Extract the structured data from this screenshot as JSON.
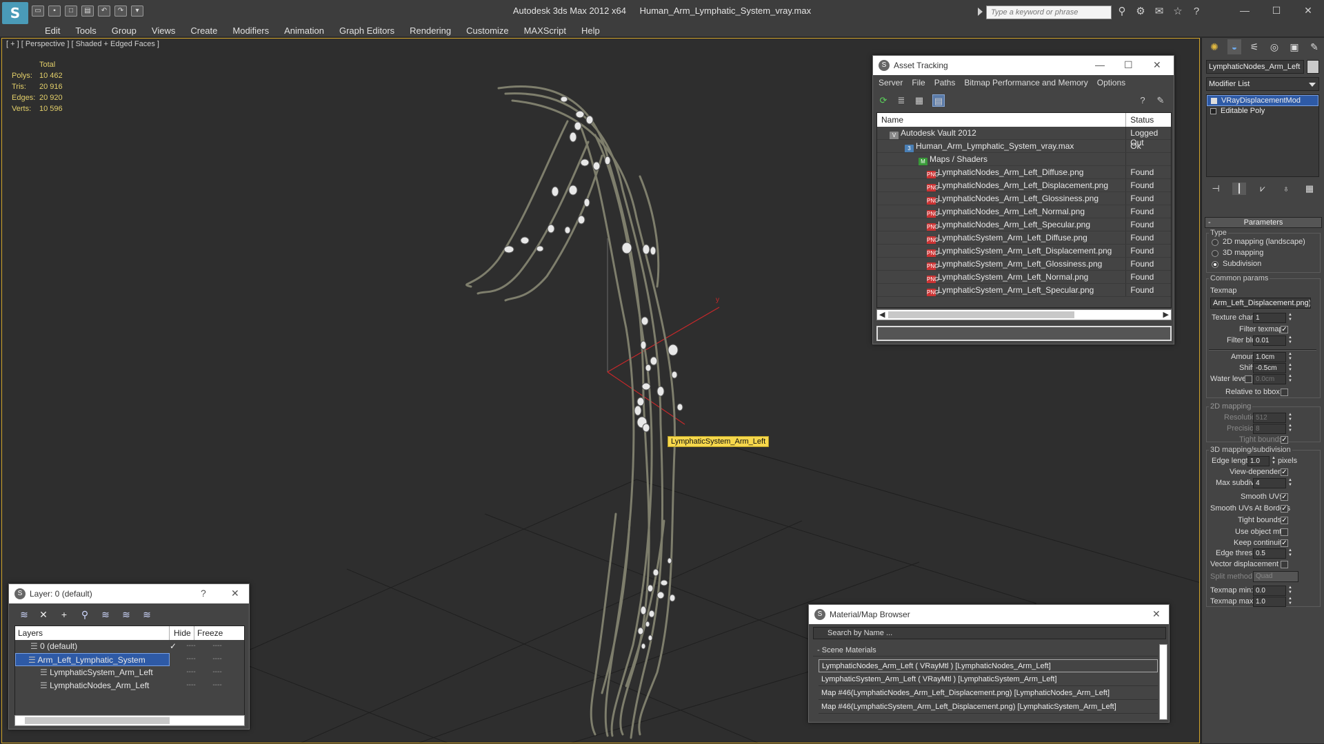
{
  "app": {
    "logo": "S",
    "title_app": "Autodesk 3ds Max  2012 x64",
    "title_file": "Human_Arm_Lymphatic_System_vray.max",
    "search_placeholder": "Type a keyword or phrase"
  },
  "menu": [
    "Edit",
    "Tools",
    "Group",
    "Views",
    "Create",
    "Modifiers",
    "Animation",
    "Graph Editors",
    "Rendering",
    "Customize",
    "MAXScript",
    "Help"
  ],
  "viewport": {
    "label": "[ + ] [ Perspective ] [ Shaded + Edged Faces ]",
    "stats_header": "Total",
    "stats": [
      {
        "k": "Polys:",
        "v": "10 462"
      },
      {
        "k": "Tris:",
        "v": "20 916"
      },
      {
        "k": "Edges:",
        "v": "20 920"
      },
      {
        "k": "Verts:",
        "v": "10 596"
      }
    ],
    "tooltip": "LymphaticSystem_Arm_Left",
    "axis_y": "y"
  },
  "asset_tracking": {
    "title": "Asset Tracking",
    "menu": [
      "Server",
      "File",
      "Paths",
      "Bitmap Performance and Memory",
      "Options"
    ],
    "col_name": "Name",
    "col_status": "Status",
    "rows": [
      {
        "name": "Autodesk Vault 2012",
        "status": "Logged Out",
        "indent": 18,
        "icon": "vault",
        "glyph": "V"
      },
      {
        "name": "Human_Arm_Lymphatic_System_vray.max",
        "status": "Ok",
        "indent": 40,
        "icon": "max",
        "glyph": "3"
      },
      {
        "name": "Maps / Shaders",
        "status": "",
        "indent": 60,
        "icon": "maps",
        "glyph": "M"
      },
      {
        "name": "LymphaticNodes_Arm_Left_Diffuse.png",
        "status": "Found",
        "indent": 72,
        "icon": "png",
        "glyph": "PNG"
      },
      {
        "name": "LymphaticNodes_Arm_Left_Displacement.png",
        "status": "Found",
        "indent": 72,
        "icon": "png",
        "glyph": "PNG"
      },
      {
        "name": "LymphaticNodes_Arm_Left_Glossiness.png",
        "status": "Found",
        "indent": 72,
        "icon": "png",
        "glyph": "PNG"
      },
      {
        "name": "LymphaticNodes_Arm_Left_Normal.png",
        "status": "Found",
        "indent": 72,
        "icon": "png",
        "glyph": "PNG"
      },
      {
        "name": "LymphaticNodes_Arm_Left_Specular.png",
        "status": "Found",
        "indent": 72,
        "icon": "png",
        "glyph": "PNG"
      },
      {
        "name": "LymphaticSystem_Arm_Left_Diffuse.png",
        "status": "Found",
        "indent": 72,
        "icon": "png",
        "glyph": "PNG"
      },
      {
        "name": "LymphaticSystem_Arm_Left_Displacement.png",
        "status": "Found",
        "indent": 72,
        "icon": "png",
        "glyph": "PNG"
      },
      {
        "name": "LymphaticSystem_Arm_Left_Glossiness.png",
        "status": "Found",
        "indent": 72,
        "icon": "png",
        "glyph": "PNG"
      },
      {
        "name": "LymphaticSystem_Arm_Left_Normal.png",
        "status": "Found",
        "indent": 72,
        "icon": "png",
        "glyph": "PNG"
      },
      {
        "name": "LymphaticSystem_Arm_Left_Specular.png",
        "status": "Found",
        "indent": 72,
        "icon": "png",
        "glyph": "PNG"
      }
    ]
  },
  "layer_panel": {
    "title": "Layer: 0 (default)",
    "help": "?",
    "col_layers": "Layers",
    "col_hide": "Hide",
    "col_freeze": "Freeze",
    "rows": [
      {
        "name": "0 (default)",
        "indent": 22,
        "check": "✓",
        "selected": false
      },
      {
        "name": "Arm_Left_Lymphatic_System",
        "indent": 18,
        "check": "",
        "selected": true
      },
      {
        "name": "LymphaticSystem_Arm_Left",
        "indent": 36,
        "check": "",
        "selected": false
      },
      {
        "name": "LymphaticNodes_Arm_Left",
        "indent": 36,
        "check": "",
        "selected": false
      }
    ],
    "dash": "----"
  },
  "material_browser": {
    "title": "Material/Map Browser",
    "search": "Search by Name ...",
    "section": "Scene Materials",
    "rows": [
      "LymphaticNodes_Arm_Left  ( VRayMtl ) [LymphaticNodes_Arm_Left]",
      "LymphaticSystem_Arm_Left  ( VRayMtl ) [LymphaticSystem_Arm_Left]",
      "Map #46(LymphaticNodes_Arm_Left_Displacement.png) [LymphaticNodes_Arm_Left]",
      "Map #46(LymphaticSystem_Arm_Left_Displacement.png) [LymphaticSystem_Arm_Left]"
    ]
  },
  "command_panel": {
    "object_name": "LymphaticNodes_Arm_Left",
    "modifier_list": "Modifier List",
    "stack": [
      "VRayDisplacementMod",
      "Editable Poly"
    ],
    "parameters": "Parameters",
    "type_label": "Type",
    "types": [
      "2D mapping (landscape)",
      "3D mapping",
      "Subdivision"
    ],
    "common_params": "Common params",
    "texmap_label": "Texmap",
    "texmap_value": "Arm_Left_Displacement.png)",
    "texture_chan": "Texture chan",
    "texture_chan_v": "1",
    "filter_texmap": "Filter texmap",
    "filter_blur": "Filter blur",
    "filter_blur_v": "0.01",
    "amount": "Amount",
    "amount_v": "1.0cm",
    "shift": "Shift",
    "shift_v": "-0.5cm",
    "water_level": "Water level",
    "water_level_v": "0.0cm",
    "relative_bbox": "Relative to bbox",
    "map2d": "2D mapping",
    "resolution": "Resolution",
    "resolution_v": "512",
    "precision": "Precision",
    "precision_v": "8",
    "tight_bounds": "Tight bounds",
    "map3d": "3D mapping/subdivision",
    "edge_length": "Edge length",
    "edge_length_v": "1.0",
    "pixels": "pixels",
    "view_dependent": "View-dependent",
    "max_subdivs": "Max subdivs",
    "max_subdivs_v": "4",
    "smooth_uvs": "Smooth UVs",
    "smooth_uvs_borders": "Smooth UVs At Borders",
    "tight_bounds2": "Tight bounds",
    "use_object_mtl": "Use object mtl",
    "keep_continuity": "Keep continuity",
    "edge_thresh": "Edge thresh",
    "edge_thresh_v": "0.5",
    "vector_disp": "Vector displacement",
    "split_method": "Split method:",
    "split_method_v": "Quad",
    "texmap_min": "Texmap min:",
    "texmap_min_v": "0.0",
    "texmap_max": "Texmap max:",
    "texmap_max_v": "1.0"
  },
  "colors": {
    "selection": "#2e5aa6",
    "tooltip": "#f7d84c",
    "stats": "#e4d06a",
    "viewport_border": "#d2a52a"
  }
}
